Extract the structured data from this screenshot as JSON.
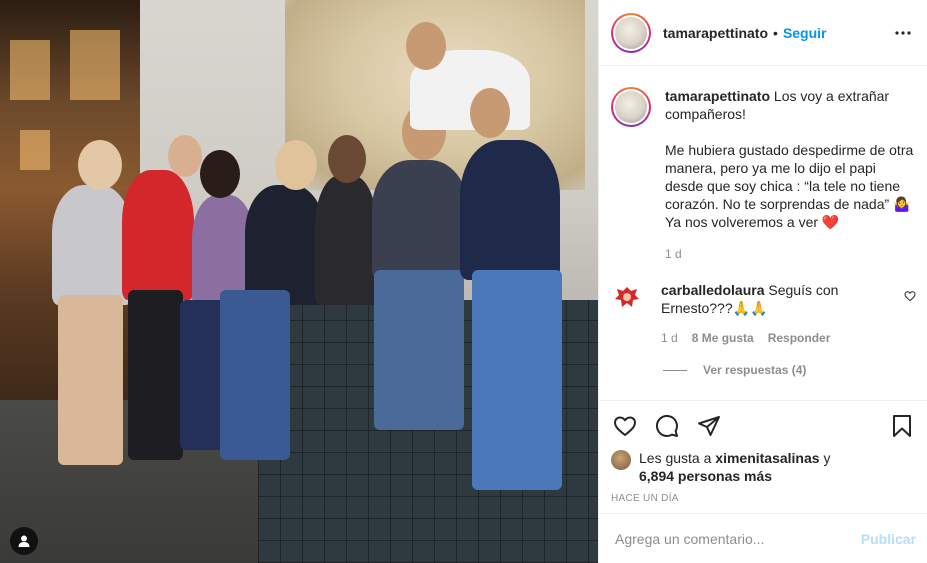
{
  "post": {
    "author": "tamarapettinato",
    "follow_label": "Seguir",
    "separator": "•",
    "more_icon": "more-horizontal-icon"
  },
  "caption": {
    "username": "tamarapettinato",
    "line1": "Los voy a extrañar compañeros!",
    "line2": "Me hubiera gustado despedirme de otra manera, pero ya me lo dijo el papi desde que soy chica : “la tele no tiene corazón. No te sorprendas de nada” 🤷‍♀️ Ya nos volveremos a ver ❤️",
    "time": "1 d"
  },
  "comment": {
    "username": "carballedolaura",
    "text": "Seguís con Ernesto???🙏🙏",
    "time": "1 d",
    "likes": "8 Me gusta",
    "reply": "Responder",
    "view_replies": "Ver respuestas (4)"
  },
  "actions": {
    "like_icon": "heart-icon",
    "comment_icon": "comment-icon",
    "share_icon": "share-icon",
    "save_icon": "bookmark-icon"
  },
  "likes": {
    "prefix": "Les gusta a",
    "user": "ximenitasalinas",
    "conj": "y",
    "count": "6,894 personas más"
  },
  "timeago": "HACE UN DÍA",
  "add_comment": {
    "placeholder": "Agrega un comentario...",
    "publish": "Publicar"
  },
  "colors": {
    "accent": "#0095f6",
    "publish_disabled": "#b2dffc",
    "muted": "#8e8e8e"
  }
}
